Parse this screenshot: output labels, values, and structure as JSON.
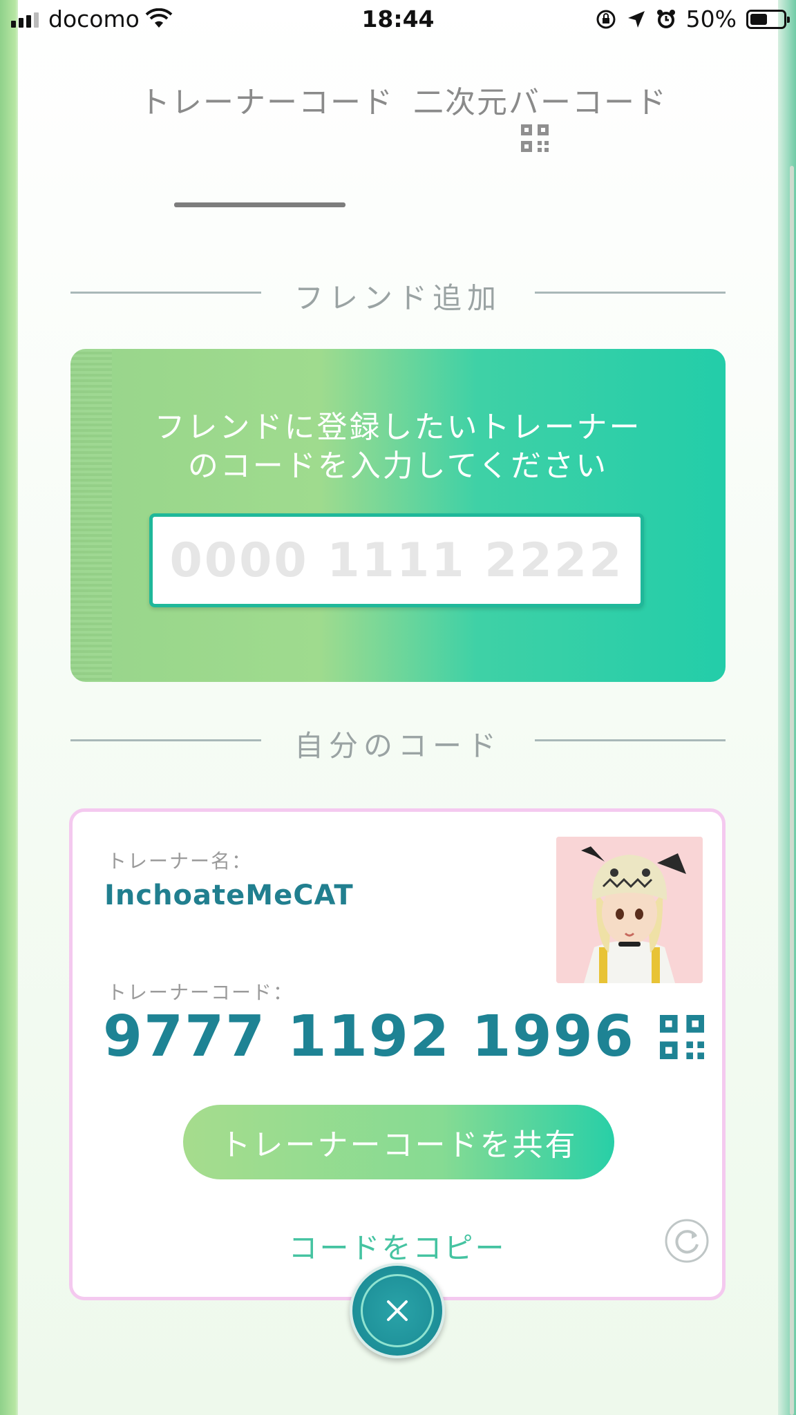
{
  "status_bar": {
    "carrier": "docomo",
    "time": "18:44",
    "battery": "50%",
    "battery_level": 0.5
  },
  "tabs": [
    {
      "label": "トレーナーコード",
      "selected": true
    },
    {
      "label": "二次元バーコード",
      "selected": false
    }
  ],
  "add_friend": {
    "section_title": "フレンド追加",
    "prompt": "フレンドに登録したいトレーナーのコードを入力してください",
    "input_placeholder": "0000 1111 2222",
    "input_value": ""
  },
  "my_code": {
    "section_title": "自分のコード",
    "name_label": "トレーナー名：",
    "name_value": "InchoateMeCAT",
    "code_label": "トレーナーコード：",
    "code_value": "9777 1192 1996",
    "share_button": "トレーナーコードを共有",
    "copy_link": "コードをコピー"
  },
  "colors": {
    "accent_teal": "#1e8394",
    "accent_green": "#23cda9",
    "card_border_pink": "#f4c9ef"
  },
  "icons": [
    "qr-code-icon",
    "refresh-icon",
    "close-icon",
    "wifi-icon",
    "location-arrow-icon",
    "alarm-icon",
    "orientation-lock-icon",
    "battery-icon"
  ]
}
